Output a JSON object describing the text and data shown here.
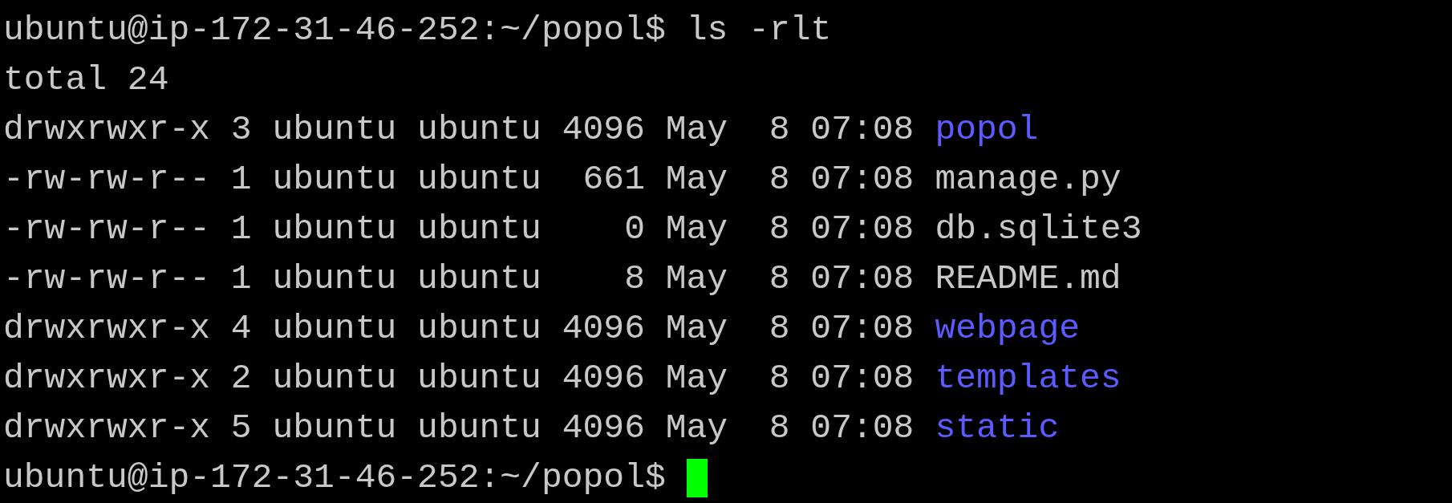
{
  "terminal": {
    "lines": [
      {
        "kind": "prompt",
        "prompt": "ubuntu@ip-172-31-46-252:~/popol$",
        "command": "ls -rlt",
        "cursor": false
      },
      {
        "kind": "output",
        "text": "total 24"
      },
      {
        "kind": "entry",
        "details": "drwxrwxr-x 3 ubuntu ubuntu 4096 May  8 07:08",
        "name": "popol",
        "directory": true
      },
      {
        "kind": "entry",
        "details": "-rw-rw-r-- 1 ubuntu ubuntu  661 May  8 07:08",
        "name": "manage.py",
        "directory": false
      },
      {
        "kind": "entry",
        "details": "-rw-rw-r-- 1 ubuntu ubuntu    0 May  8 07:08",
        "name": "db.sqlite3",
        "directory": false
      },
      {
        "kind": "entry",
        "details": "-rw-rw-r-- 1 ubuntu ubuntu    8 May  8 07:08",
        "name": "README.md",
        "directory": false
      },
      {
        "kind": "entry",
        "details": "drwxrwxr-x 4 ubuntu ubuntu 4096 May  8 07:08",
        "name": "webpage",
        "directory": true
      },
      {
        "kind": "entry",
        "details": "drwxrwxr-x 2 ubuntu ubuntu 4096 May  8 07:08",
        "name": "templates",
        "directory": true
      },
      {
        "kind": "entry",
        "details": "drwxrwxr-x 5 ubuntu ubuntu 4096 May  8 07:08",
        "name": "static",
        "directory": true
      },
      {
        "kind": "prompt",
        "prompt": "ubuntu@ip-172-31-46-252:~/popol$",
        "cursor": true
      }
    ]
  }
}
